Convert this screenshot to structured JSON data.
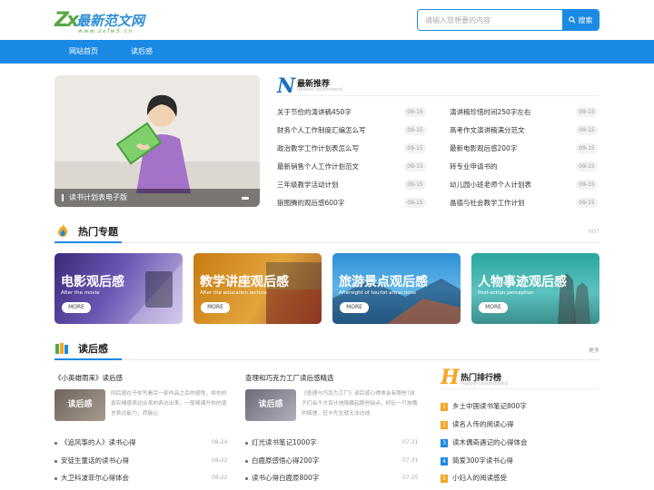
{
  "header": {
    "logo_mark": "Zx",
    "logo_text": "最新范文网",
    "logo_url": "www.zxfw5.cn",
    "search_placeholder": "请输入您想要的内容",
    "search_button": "搜索"
  },
  "nav": {
    "items": [
      "网站首页",
      "读后感"
    ]
  },
  "slider": {
    "caption": "读书计划表电子版"
  },
  "newest": {
    "letter": "N",
    "title": "最新推荐",
    "subtitle": "Newest recommend",
    "left": [
      {
        "title": "关于节俭的演讲稿450字",
        "date": "09-15"
      },
      {
        "title": "财务个人工作制度汇编怎么写",
        "date": "09-15"
      },
      {
        "title": "政治教学工作计划表怎么写",
        "date": "09-15"
      },
      {
        "title": "最新销售个人工作计划范文",
        "date": "09-15"
      },
      {
        "title": "三年级教学活动计划",
        "date": "09-15"
      },
      {
        "title": "狼图腾的观后感600字",
        "date": "09-15"
      }
    ],
    "right": [
      {
        "title": "演讲稿珍惜时间250字左右",
        "date": "09-15"
      },
      {
        "title": "高考作文演讲稿满分范文",
        "date": "09-15"
      },
      {
        "title": "最新电影观后感200字",
        "date": "09-15"
      },
      {
        "title": "转专业申请书的",
        "date": "09-15"
      },
      {
        "title": "幼儿园小班老师个人计划表",
        "date": "09-15"
      },
      {
        "title": "晶德与社会教学工作计划",
        "date": "09-15"
      }
    ]
  },
  "hot": {
    "title": "热门专题",
    "right_label": "HOT",
    "topics": [
      {
        "title": "电影观后感",
        "sub": "After the movie",
        "more": "MORE"
      },
      {
        "title": "教学讲座观后感",
        "sub": "After the education lecture",
        "more": "MORE"
      },
      {
        "title": "旅游景点观后感",
        "sub": "Aftersight of tourist attractions",
        "more": "MORE"
      },
      {
        "title": "人物事迹观后感",
        "sub": "Post-action perception",
        "more": "MORE"
      }
    ]
  },
  "reviews": {
    "title": "读后感",
    "more": "更多",
    "col1": {
      "heading": "《小英雄雨来》读后感",
      "thumb_label": "读后感",
      "excerpt": "同后感在于你写看完一部作品之后的感悟，将你的真实情感表达出来的表达出来，一般够课升你的语言表达能力，而能让",
      "items": [
        {
          "title": "《追风筝的人》读书心得",
          "date": "08-24"
        },
        {
          "title": "安徒生童话的读书心得",
          "date": "08-22"
        },
        {
          "title": "大卫科波菲尔心得体会",
          "date": "08-22"
        }
      ]
    },
    "col2": {
      "heading": "查理和巧克力工厂读后感精选",
      "thumb_label": "读后感",
      "excerpt": "《查理与巧克力工厂》读后感心得体会有哪些?孩子们会千方百计地隐藏起那些缺点，好比一只放鹰的狐狸，狂卡先生就无法达成",
      "items": [
        {
          "title": "灯光读书笔记1000字",
          "date": "07-31"
        },
        {
          "title": "白鹿原感悟心得200字",
          "date": "07-31"
        },
        {
          "title": "读书心得白鹿原800字",
          "date": "07-25"
        }
      ]
    }
  },
  "ranking": {
    "letter": "H",
    "title": "热门排行榜",
    "subtitle": "Popular Leaderboard",
    "items": [
      {
        "num": "1",
        "title": "乡土中国读书笔记800字"
      },
      {
        "num": "2",
        "title": "读名人传的阅读心得"
      },
      {
        "num": "3",
        "title": "读木偶奇遇记的心得体会"
      },
      {
        "num": "4",
        "title": "简爱300字读书心得"
      },
      {
        "num": "5",
        "title": "小妇人的阅读感受"
      }
    ]
  },
  "colors": {
    "primary": "#1a8ae4",
    "rank_num": [
      "#f5a623",
      "#f5a623",
      "#1a8ae4",
      "#1a8ae4",
      "#f5a623"
    ]
  }
}
